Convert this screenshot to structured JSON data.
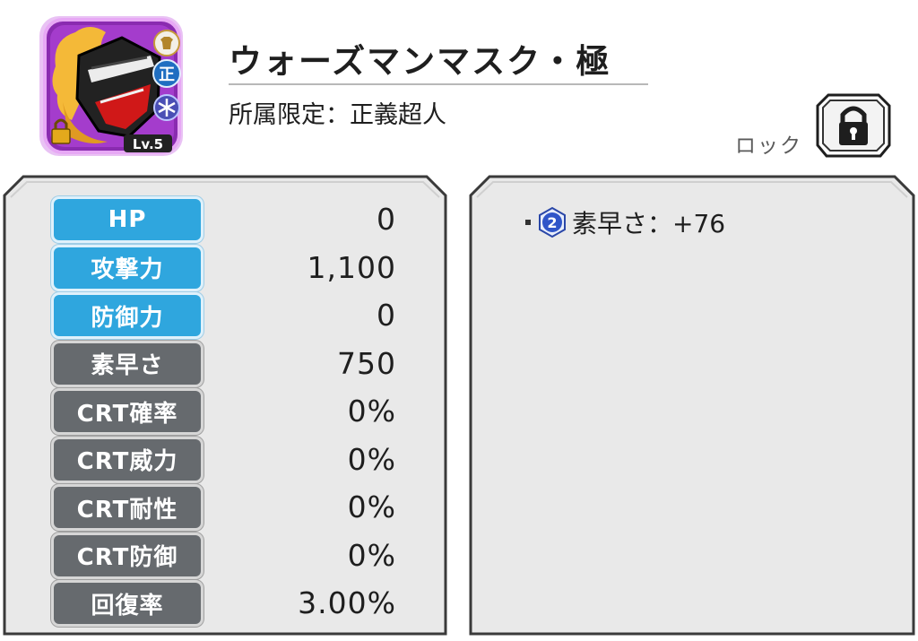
{
  "item": {
    "name": "ウォーズマンマスク・極",
    "affiliation": "所属限定：正義超人",
    "level": "Lv.5",
    "attribute_glyph": "正",
    "icon": "warsman-mask-icon"
  },
  "lock": {
    "label": "ロック",
    "icon": "padlock-icon"
  },
  "stats": [
    {
      "label": "HP",
      "value": "0",
      "style": "blue"
    },
    {
      "label": "攻撃力",
      "value": "1,100",
      "style": "blue"
    },
    {
      "label": "防御力",
      "value": "0",
      "style": "blue"
    },
    {
      "label": "素早さ",
      "value": "750",
      "style": "gray"
    },
    {
      "label": "CRT確率",
      "value": "0%",
      "style": "gray"
    },
    {
      "label": "CRT威力",
      "value": "0%",
      "style": "gray"
    },
    {
      "label": "CRT耐性",
      "value": "0%",
      "style": "gray"
    },
    {
      "label": "CRT防御",
      "value": "0%",
      "style": "gray"
    },
    {
      "label": "回復率",
      "value": "3.00%",
      "style": "gray"
    }
  ],
  "skills": [
    {
      "badge": "2",
      "text": "素早さ：+76"
    }
  ],
  "colors": {
    "stat_blue": "#2fa6de",
    "stat_gray": "#666a6e",
    "panel_bg": "#e8e8e8",
    "icon_purple": "#b23cd6"
  }
}
